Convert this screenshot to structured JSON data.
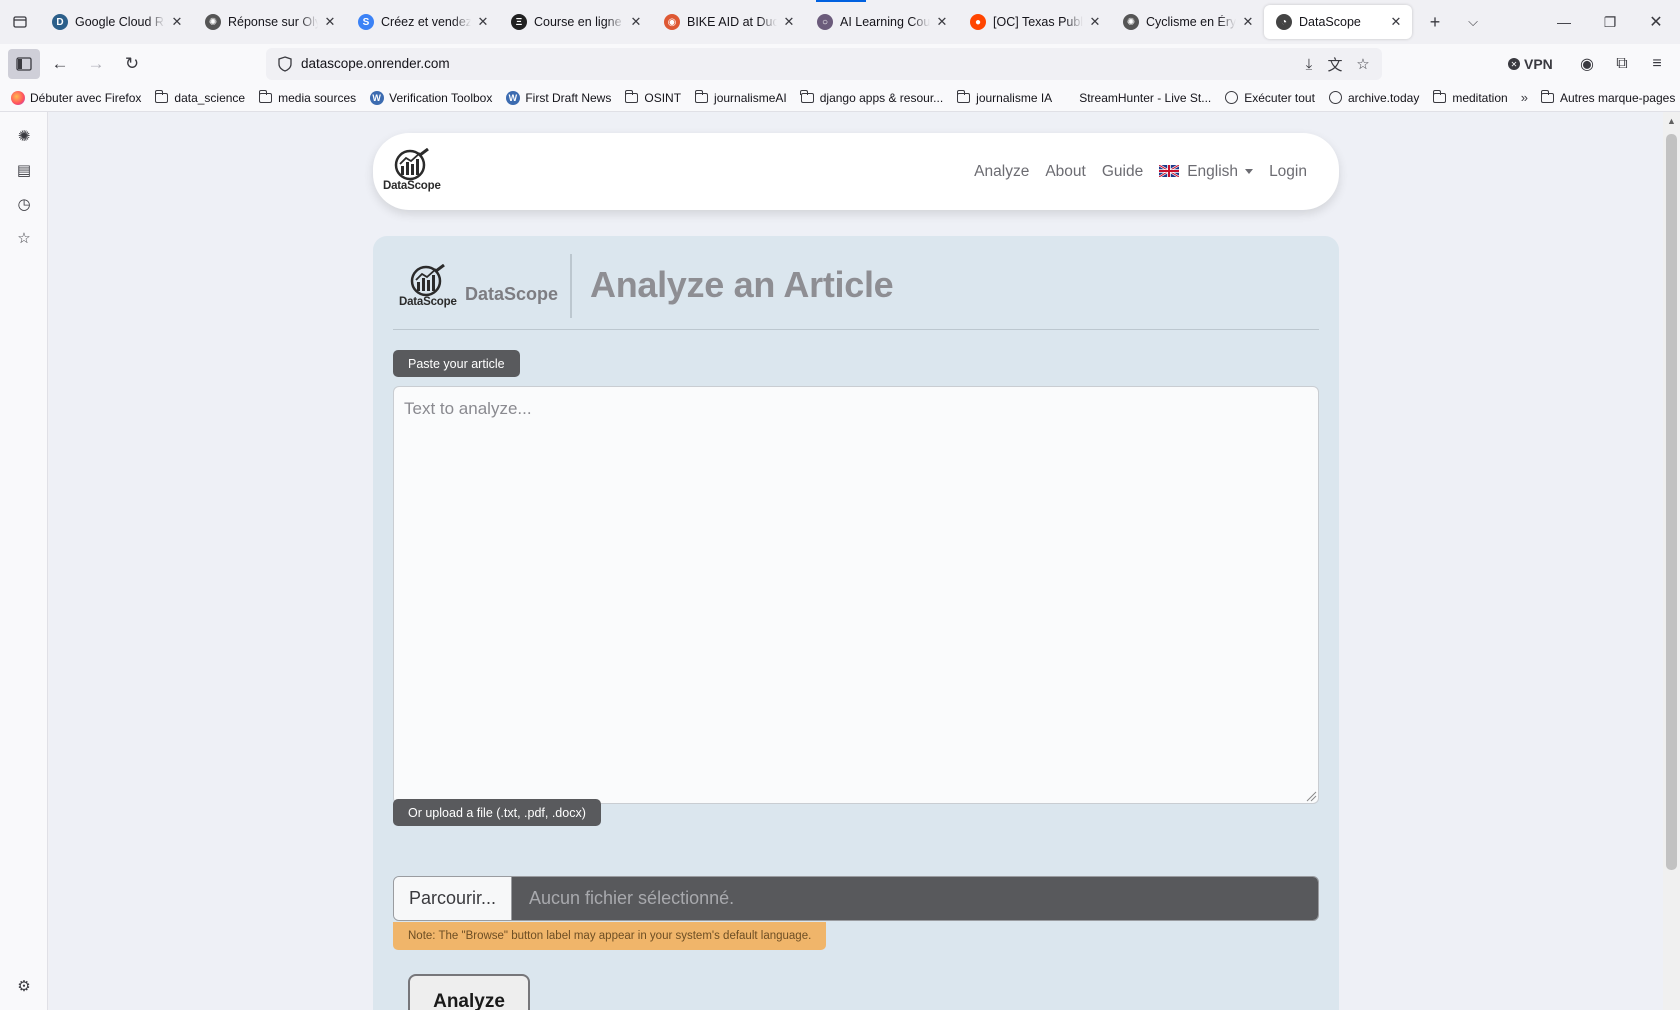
{
  "browser": {
    "tabs": [
      {
        "title": "Google Cloud Rap",
        "favicon_color": "#2c5f8a",
        "favicon_glyph": "D"
      },
      {
        "title": "Réponse sur Olym",
        "favicon_color": "#555555",
        "favicon_glyph": "✺"
      },
      {
        "title": "Créez et vendez v",
        "favicon_color": "#3b82f6",
        "favicon_glyph": "S"
      },
      {
        "title": "Course en ligne H",
        "favicon_color": "#222222",
        "favicon_glyph": "Ξ"
      },
      {
        "title": "BIKE AID at DuckD",
        "favicon_color": "#de5833",
        "favicon_glyph": "◉"
      },
      {
        "title": "AI Learning Cours",
        "favicon_color": "#6b5b7b",
        "favicon_glyph": "○"
      },
      {
        "title": "[OC] Texas Public",
        "favicon_color": "#ff4500",
        "favicon_glyph": "●"
      },
      {
        "title": "Cyclisme en Éryth",
        "favicon_color": "#555555",
        "favicon_glyph": "✺"
      },
      {
        "title": "DataScope",
        "favicon_color": "#444444",
        "favicon_glyph": "◔",
        "active": true
      }
    ],
    "url": "datascope.onrender.com",
    "vpn_label": "VPN",
    "bookmarks": [
      {
        "label": "Débuter avec Firefox",
        "icon": "firefox-icon"
      },
      {
        "label": "data_science",
        "icon": "folder-icon"
      },
      {
        "label": "media sources",
        "icon": "folder-icon"
      },
      {
        "label": "Verification Toolbox",
        "icon": "wordpress-icon"
      },
      {
        "label": "First Draft News",
        "icon": "wordpress-icon"
      },
      {
        "label": "OSINT",
        "icon": "folder-icon"
      },
      {
        "label": "journalismeAI",
        "icon": "folder-icon"
      },
      {
        "label": "django apps & resour...",
        "icon": "folder-icon"
      },
      {
        "label": "journalisme IA",
        "icon": "folder-icon"
      },
      {
        "label": "StreamHunter - Live St...",
        "icon": "none"
      },
      {
        "label": "Exécuter tout",
        "icon": "globe-icon"
      },
      {
        "label": "archive.today",
        "icon": "globe-icon"
      },
      {
        "label": "meditation",
        "icon": "folder-icon"
      }
    ],
    "other_bookmarks": "Autres marque-pages"
  },
  "site": {
    "logo_text": "DataScope",
    "nav": {
      "analyze": "Analyze",
      "about": "About",
      "guide": "Guide",
      "language": "English",
      "login": "Login"
    }
  },
  "main": {
    "brand": "DataScope",
    "title": "Analyze an Article",
    "paste_label": "Paste your article",
    "textarea_placeholder": "Text to analyze...",
    "upload_label": "Or upload a file (.txt, .pdf, .docx)",
    "browse_label": "Parcourir...",
    "file_status": "Aucun fichier sélectionné.",
    "note": "Note: The \"Browse\" button label may appear in your system's default language.",
    "analyze_button": "Analyze"
  },
  "colors": {
    "card_bg": "#dbe6ee",
    "pill_bg": "#595a5d",
    "note_bg": "#f0b56a"
  }
}
